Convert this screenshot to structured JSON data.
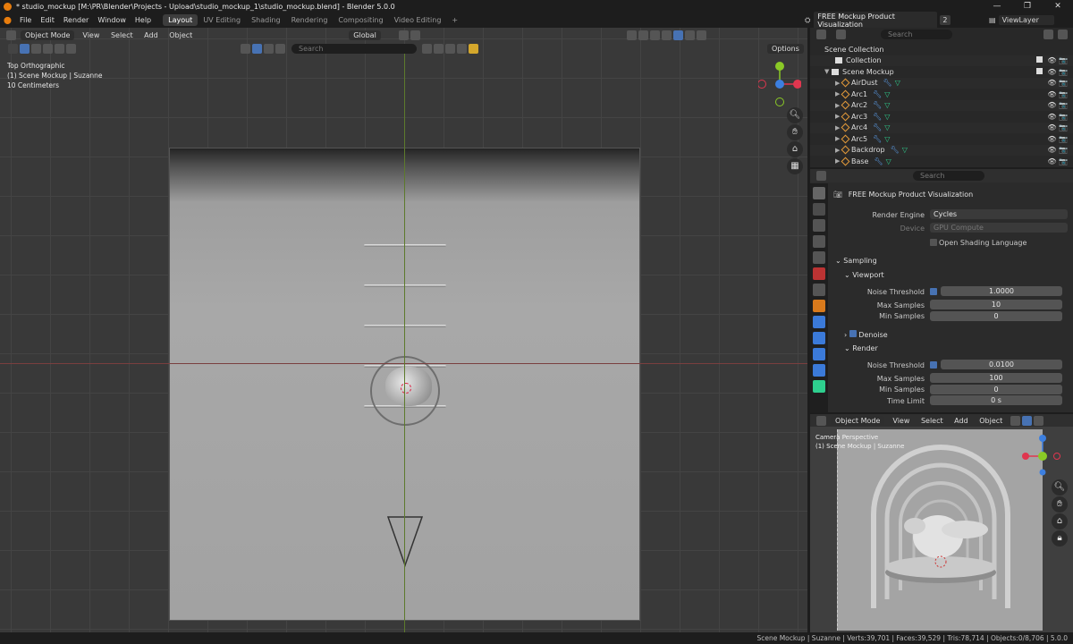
{
  "window": {
    "title": "* studio_mockup [M:\\PR\\Blender\\Projects - Upload\\studio_mockup_1\\studio_mockup.blend] - Blender 5.0.0",
    "controls": [
      "—",
      "❐",
      "✕"
    ]
  },
  "menu": [
    "File",
    "Edit",
    "Render",
    "Window",
    "Help"
  ],
  "workspaces": [
    "Layout",
    "UV Editing",
    "Shading",
    "Rendering",
    "Compositing",
    "Video Editing"
  ],
  "active_workspace": "Layout",
  "scene": {
    "name": "FREE Mockup Product Visualization",
    "users": "2",
    "view_layer": "ViewLayer"
  },
  "viewport": {
    "mode": "Object Mode",
    "menu": [
      "View",
      "Select",
      "Add",
      "Object"
    ],
    "orientation": "Global",
    "search_placeholder": "Search",
    "options_label": "Options",
    "info": [
      "Top Orthographic",
      "(1) Scene Mockup | Suzanne",
      "10 Centimeters"
    ]
  },
  "outliner": {
    "search_placeholder": "Search",
    "rows": [
      {
        "label": "Scene Collection",
        "kind": "scene"
      },
      {
        "label": "Collection",
        "kind": "collection"
      },
      {
        "label": "Scene Mockup",
        "kind": "collection"
      },
      {
        "label": "AirDust",
        "kind": "object"
      },
      {
        "label": "Arc1",
        "kind": "object"
      },
      {
        "label": "Arc2",
        "kind": "object"
      },
      {
        "label": "Arc3",
        "kind": "object"
      },
      {
        "label": "Arc4",
        "kind": "object"
      },
      {
        "label": "Arc5",
        "kind": "object"
      },
      {
        "label": "Backdrop",
        "kind": "object"
      },
      {
        "label": "Base",
        "kind": "object"
      }
    ]
  },
  "properties": {
    "search_placeholder": "Search",
    "context_title": "FREE Mockup Product Visualization",
    "render_engine_label": "Render Engine",
    "render_engine_value": "Cycles",
    "device_label": "Device",
    "device_value": "GPU Compute",
    "osl_label": "Open Shading Language",
    "sampling_label": "Sampling",
    "viewport_label": "Viewport",
    "noise_threshold_label": "Noise Threshold",
    "viewport_noise_threshold": "1.0000",
    "max_samples_label": "Max Samples",
    "viewport_max_samples": "10",
    "min_samples_label": "Min Samples",
    "viewport_min_samples": "0",
    "denoise_label": "Denoise",
    "render_label": "Render",
    "render_noise_threshold": "0.0100",
    "render_max_samples": "100",
    "render_min_samples": "0",
    "time_limit_label": "Time Limit",
    "render_time_limit": "0 s"
  },
  "camera_view": {
    "mode": "Object Mode",
    "menu": [
      "View",
      "Select",
      "Add",
      "Object"
    ],
    "info": [
      "Camera Perspective",
      "(1) Scene Mockup | Suzanne"
    ]
  },
  "statusbar": "Scene Mockup | Suzanne | Verts:39,701 | Faces:39,529 | Tris:78,714 | Objects:0/8,706 | 5.0.0"
}
